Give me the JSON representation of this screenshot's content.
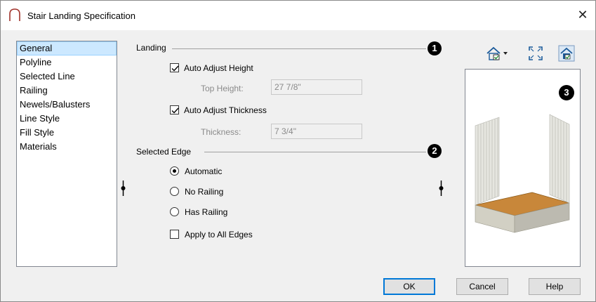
{
  "window": {
    "title": "Stair Landing Specification",
    "close_label": "✕"
  },
  "categories": [
    {
      "label": "General",
      "selected": true
    },
    {
      "label": "Polyline"
    },
    {
      "label": "Selected Line"
    },
    {
      "label": "Railing"
    },
    {
      "label": "Newels/Balusters"
    },
    {
      "label": "Line Style"
    },
    {
      "label": "Fill Style"
    },
    {
      "label": "Materials"
    }
  ],
  "landing": {
    "section_label": "Landing",
    "callout": "1",
    "auto_adjust_height": {
      "label": "Auto Adjust Height",
      "checked": true
    },
    "top_height": {
      "label": "Top Height:",
      "value": "27 7/8\""
    },
    "auto_adjust_thickness": {
      "label": "Auto Adjust Thickness",
      "checked": true
    },
    "thickness": {
      "label": "Thickness:",
      "value": "7 3/4\""
    }
  },
  "selected_edge": {
    "section_label": "Selected Edge",
    "callout": "2",
    "options": [
      {
        "label": "Automatic",
        "selected": true
      },
      {
        "label": "No Railing",
        "selected": false
      },
      {
        "label": "Has Railing",
        "selected": false
      }
    ],
    "apply_all": {
      "label": "Apply to All Edges",
      "checked": false
    }
  },
  "preview": {
    "callout": "3"
  },
  "buttons": {
    "ok": "OK",
    "cancel": "Cancel",
    "help": "Help"
  },
  "colors": {
    "selection_bg": "#cce8ff",
    "default_button_border": "#0078d7",
    "floor_wood": "#c8873a",
    "railing_gray": "#dcdcd4"
  }
}
